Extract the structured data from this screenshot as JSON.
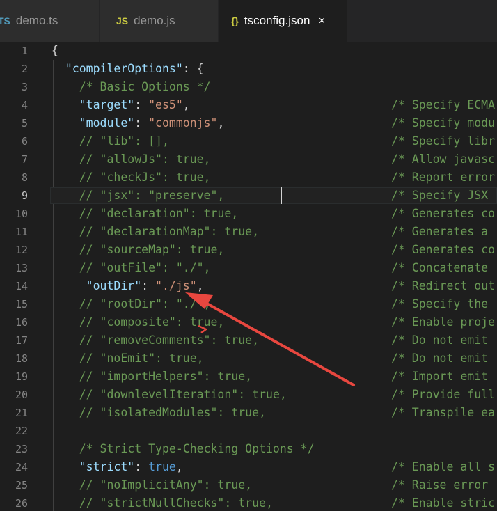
{
  "tabs": [
    {
      "icon": "TS",
      "label": "demo.ts",
      "active": false
    },
    {
      "icon": "JS",
      "label": "demo.js",
      "active": false
    },
    {
      "icon": "{}",
      "label": "tsconfig.json",
      "active": true,
      "close": "×"
    }
  ],
  "colors": {
    "background": "#1e1e1e",
    "key": "#9cdcfe",
    "string": "#ce9178",
    "boolean": "#569cd6",
    "comment": "#6a9955",
    "arrow": "#e8473f"
  },
  "current_line": 9,
  "lines": [
    {
      "n": "1",
      "code": [
        [
          "p",
          "{"
        ]
      ],
      "comment": ""
    },
    {
      "n": "2",
      "code": [
        [
          "p",
          "  "
        ],
        [
          "k",
          "\"compilerOptions\""
        ],
        [
          "p",
          ": {"
        ]
      ],
      "comment": ""
    },
    {
      "n": "3",
      "code": [
        [
          "p",
          "    "
        ],
        [
          "c",
          "/* Basic Options */"
        ]
      ],
      "comment": ""
    },
    {
      "n": "4",
      "code": [
        [
          "p",
          "    "
        ],
        [
          "k",
          "\"target\""
        ],
        [
          "p",
          ": "
        ],
        [
          "s",
          "\"es5\""
        ],
        [
          "p",
          ","
        ]
      ],
      "comment": "/* Specify ECMA"
    },
    {
      "n": "5",
      "code": [
        [
          "p",
          "    "
        ],
        [
          "k",
          "\"module\""
        ],
        [
          "p",
          ": "
        ],
        [
          "s",
          "\"commonjs\""
        ],
        [
          "p",
          ","
        ]
      ],
      "comment": "/* Specify modu"
    },
    {
      "n": "6",
      "code": [
        [
          "p",
          "    "
        ],
        [
          "c",
          "// \"lib\": [],"
        ]
      ],
      "comment": "/* Specify libr"
    },
    {
      "n": "7",
      "code": [
        [
          "p",
          "    "
        ],
        [
          "c",
          "// \"allowJs\": true,"
        ]
      ],
      "comment": "/* Allow javasc"
    },
    {
      "n": "8",
      "code": [
        [
          "p",
          "    "
        ],
        [
          "c",
          "// \"checkJs\": true,"
        ]
      ],
      "comment": "/* Report error"
    },
    {
      "n": "9",
      "code": [
        [
          "p",
          "    "
        ],
        [
          "c",
          "// \"jsx\": \"preserve\","
        ]
      ],
      "comment": "/* Specify JSX"
    },
    {
      "n": "10",
      "code": [
        [
          "p",
          "    "
        ],
        [
          "c",
          "// \"declaration\": true,"
        ]
      ],
      "comment": "/* Generates co"
    },
    {
      "n": "11",
      "code": [
        [
          "p",
          "    "
        ],
        [
          "c",
          "// \"declarationMap\": true,"
        ]
      ],
      "comment": "/* Generates a"
    },
    {
      "n": "12",
      "code": [
        [
          "p",
          "    "
        ],
        [
          "c",
          "// \"sourceMap\": true,"
        ]
      ],
      "comment": "/* Generates co"
    },
    {
      "n": "13",
      "code": [
        [
          "p",
          "    "
        ],
        [
          "c",
          "// \"outFile\": \"./\","
        ]
      ],
      "comment": "/* Concatenate"
    },
    {
      "n": "14",
      "code": [
        [
          "p",
          "     "
        ],
        [
          "k",
          "\"outDir\""
        ],
        [
          "p",
          ": "
        ],
        [
          "s",
          "\"./js\""
        ],
        [
          "p",
          ","
        ]
      ],
      "comment": "/* Redirect out"
    },
    {
      "n": "15",
      "code": [
        [
          "p",
          "    "
        ],
        [
          "c",
          "// \"rootDir\": \"./\","
        ]
      ],
      "comment": "/* Specify the"
    },
    {
      "n": "16",
      "code": [
        [
          "p",
          "    "
        ],
        [
          "c",
          "// \"composite\": true,"
        ]
      ],
      "comment": "/* Enable proje"
    },
    {
      "n": "17",
      "code": [
        [
          "p",
          "    "
        ],
        [
          "c",
          "// \"removeComments\": true,"
        ]
      ],
      "comment": "/* Do not emit"
    },
    {
      "n": "18",
      "code": [
        [
          "p",
          "    "
        ],
        [
          "c",
          "// \"noEmit\": true,"
        ]
      ],
      "comment": "/* Do not emit"
    },
    {
      "n": "19",
      "code": [
        [
          "p",
          "    "
        ],
        [
          "c",
          "// \"importHelpers\": true,"
        ]
      ],
      "comment": "/* Import emit"
    },
    {
      "n": "20",
      "code": [
        [
          "p",
          "    "
        ],
        [
          "c",
          "// \"downlevelIteration\": true,"
        ]
      ],
      "comment": "/* Provide full"
    },
    {
      "n": "21",
      "code": [
        [
          "p",
          "    "
        ],
        [
          "c",
          "// \"isolatedModules\": true,"
        ]
      ],
      "comment": "/* Transpile ea"
    },
    {
      "n": "22",
      "code": [],
      "comment": ""
    },
    {
      "n": "23",
      "code": [
        [
          "p",
          "    "
        ],
        [
          "c",
          "/* Strict Type-Checking Options */"
        ]
      ],
      "comment": ""
    },
    {
      "n": "24",
      "code": [
        [
          "p",
          "    "
        ],
        [
          "k",
          "\"strict\""
        ],
        [
          "p",
          ": "
        ],
        [
          "b",
          "true"
        ],
        [
          "p",
          ","
        ]
      ],
      "comment": "/* Enable all s"
    },
    {
      "n": "25",
      "code": [
        [
          "p",
          "    "
        ],
        [
          "c",
          "// \"noImplicitAny\": true,"
        ]
      ],
      "comment": "/* Raise error"
    },
    {
      "n": "26",
      "code": [
        [
          "p",
          "    "
        ],
        [
          "c",
          "// \"strictNullChecks\": true,"
        ]
      ],
      "comment": "/* Enable stric"
    }
  ]
}
